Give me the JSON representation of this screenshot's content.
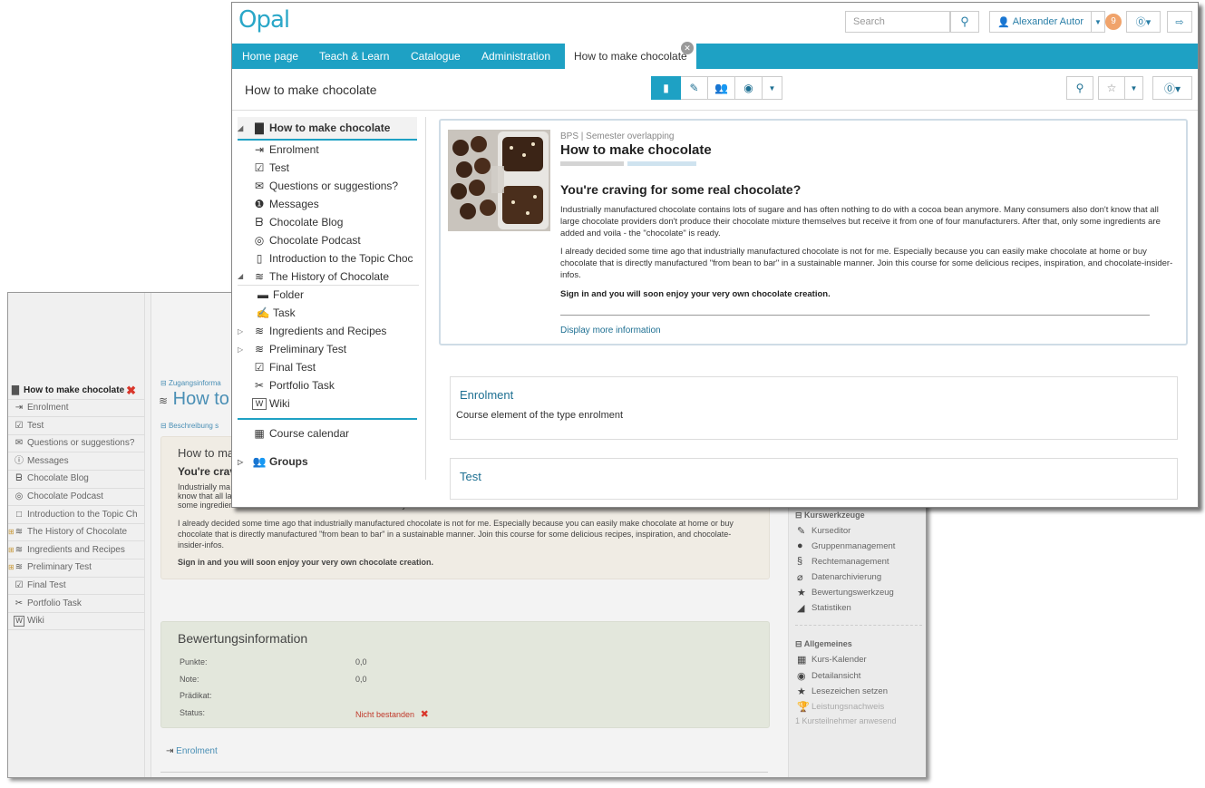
{
  "back": {
    "tree": {
      "root": "How to make chocolate",
      "items": [
        {
          "icon": "enrolment-icon",
          "label": "Enrolment"
        },
        {
          "icon": "test-icon",
          "label": "Test"
        },
        {
          "icon": "mail-icon",
          "label": "Questions or suggestions?"
        },
        {
          "icon": "info-icon",
          "label": "Messages"
        },
        {
          "icon": "blog-icon",
          "label": "Chocolate Blog"
        },
        {
          "icon": "podcast-icon",
          "label": "Chocolate Podcast"
        },
        {
          "icon": "page-icon",
          "label": "Introduction to the Topic Ch"
        },
        {
          "icon": "layers-icon",
          "label": "The History of Chocolate"
        },
        {
          "icon": "layers-icon",
          "label": "Ingredients and Recipes"
        },
        {
          "icon": "layers-icon",
          "label": "Preliminary Test"
        },
        {
          "icon": "test-icon",
          "label": "Final Test"
        },
        {
          "icon": "portfolio-icon",
          "label": "Portfolio Task"
        },
        {
          "icon": "wiki-icon",
          "label": "Wiki"
        }
      ]
    },
    "zugang": "Zugangsinforma",
    "title": "How to",
    "beschreibung": "Beschreibung s",
    "info": {
      "title": "How to ma",
      "heading": "You're crav",
      "p1a": "Industrially ma",
      "p1b": "know that all la",
      "p1c": "some ingredients are added and voila - the \"chocolate\" is ready.",
      "p2": "I already decided some time ago that industrially manufactured chocolate is not for me. Especially because you can easily make chocolate at home or buy chocolate that is directly manufactured \"from bean to bar\" in a sustainable manner. Join this course for some delicious recipes, inspiration, and chocolate-insider-infos.",
      "p3": "Sign in and you will soon enjoy your very own chocolate creation."
    },
    "bewertung": {
      "title": "Bewertungsinformation",
      "rows": [
        {
          "label": "Punkte:",
          "value": "0,0"
        },
        {
          "label": "Note:",
          "value": "0,0"
        },
        {
          "label": "Prädikat:",
          "value": ""
        },
        {
          "label": "Status:",
          "value": "Nicht bestanden"
        }
      ]
    },
    "enrolment_link": "Enrolment",
    "side": {
      "kurswerkzeuge": "Kurswerkzeuge",
      "tools": [
        "Kurseditor",
        "Gruppenmanagement",
        "Rechtemanagement",
        "Datenarchivierung",
        "Bewertungswerkzeug",
        "Statistiken"
      ],
      "allgemeines": "Allgemeines",
      "general": [
        "Kurs-Kalender",
        "Detailansicht",
        "Lesezeichen setzen",
        "Leistungsnachweis"
      ],
      "present": "1 Kursteilnehmer anwesend"
    }
  },
  "front": {
    "logo": "Opal",
    "search_placeholder": "Search",
    "user": "Alexander Autor",
    "notifications": "9",
    "nav": {
      "tabs": [
        "Home page",
        "Teach & Learn",
        "Catalogue",
        "Administration"
      ],
      "active_tab": "How to make chocolate"
    },
    "page_title": "How to make chocolate",
    "tree": {
      "root": "How to make chocolate",
      "items": [
        {
          "label": "Enrolment"
        },
        {
          "label": "Test"
        },
        {
          "label": "Questions or suggestions?"
        },
        {
          "label": "Messages"
        },
        {
          "label": "Chocolate Blog"
        },
        {
          "label": "Chocolate Podcast"
        },
        {
          "label": "Introduction to the Topic Choc"
        },
        {
          "label": "The History of Chocolate"
        },
        {
          "label": "Folder"
        },
        {
          "label": "Task"
        },
        {
          "label": "Ingredients and Recipes"
        },
        {
          "label": "Preliminary Test"
        },
        {
          "label": "Final Test"
        },
        {
          "label": "Portfolio Task"
        },
        {
          "label": "Wiki"
        }
      ],
      "calendar": "Course calendar",
      "groups": "Groups"
    },
    "course": {
      "meta": "BPS | Semester overlapping",
      "title": "How to make chocolate",
      "heading": "You're craving for some real chocolate?",
      "p1": "Industrially manufactured chocolate contains lots of sugare and has often nothing to do with a cocoa bean anymore. Many consumers also don't know that all large chocolate providers don't produce their chocolate mixture themselves but receive it from one of four manufacturers. After that, only some ingredients are added and voila - the \"chocolate\" is ready.",
      "p2": "I already decided some time ago that industrially manufactured chocolate is not for me. Especially because you can easily make chocolate at home or buy chocolate that is directly manufactured \"from bean to bar\" in a sustainable manner. Join this course for some delicious recipes, inspiration, and chocolate-insider-infos.",
      "p3": "Sign in and you will soon enjoy your very own chocolate creation.",
      "more": "Display more information"
    },
    "enrolment": {
      "title": "Enrolment",
      "desc": "Course element of the type enrolment"
    },
    "test": {
      "title": "Test"
    }
  }
}
